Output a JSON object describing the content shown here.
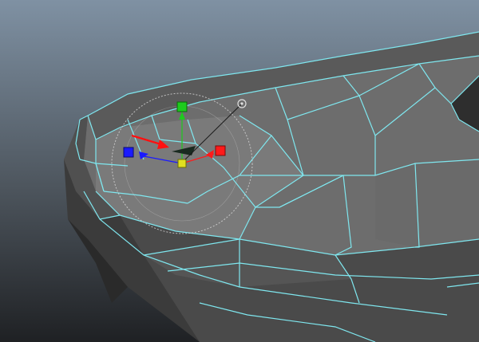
{
  "viewport": {
    "kind": "3d-modeling-viewport",
    "background_top": "#7f91a3",
    "background_bottom": "#1f2124",
    "wireframe_color": "#7fe7ef",
    "mesh_face_color": "#6d6d6d"
  },
  "manipulator": {
    "type": "move-tool",
    "axis_colors": {
      "x": "#ff1a1a",
      "y": "#1ecb1e",
      "z": "#1a1aff",
      "center": "#e0e020"
    }
  },
  "annotation": {
    "arrow_color": "#ff1010",
    "points_to": "selected-vertex"
  }
}
